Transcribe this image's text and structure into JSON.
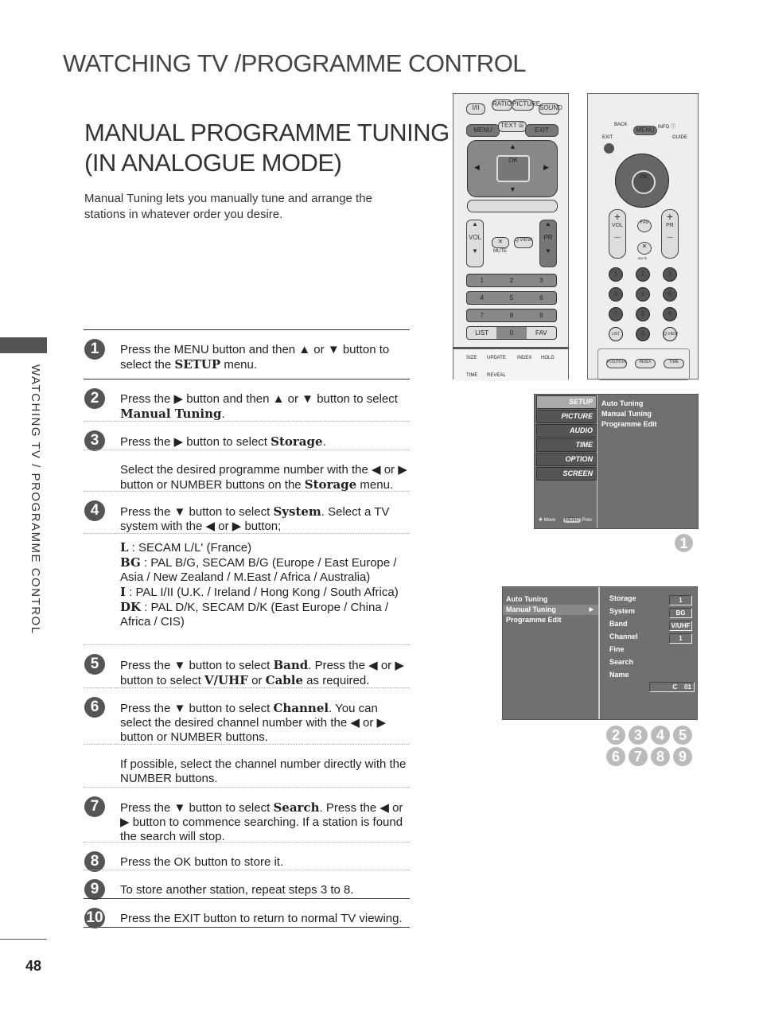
{
  "header": {
    "title": "WATCHING TV /PROGRAMME CONTROL"
  },
  "section": {
    "title_line1": "MANUAL PROGRAMME TUNING",
    "title_line2": "(IN ANALOGUE MODE)",
    "intro": "Manual Tuning lets you manually tune and arrange the stations in whatever order you desire."
  },
  "sidebar": {
    "label": "WATCHING TV / PROGRAMME CONTROL"
  },
  "page_number": "48",
  "steps": [
    {
      "num": "1",
      "segments": [
        [
          "Press the "
        ],
        [
          "MENU"
        ],
        [
          " button and then ▲ or ▼ button to select the "
        ],
        [
          "SETUP",
          "b"
        ],
        [
          " menu."
        ]
      ]
    },
    {
      "num": "2",
      "segments": [
        [
          "Press the ▶ button and then ▲ or ▼ button to select "
        ],
        [
          "Manual Tuning",
          "b"
        ],
        [
          "."
        ]
      ]
    },
    {
      "num": "3",
      "segments": [
        [
          "Press the ▶ button to select "
        ],
        [
          "Storage",
          "b"
        ],
        [
          "."
        ]
      ]
    },
    {
      "num": "",
      "segments": [
        [
          "Select the desired programme number with the ◀ or ▶ button or NUMBER buttons on the "
        ],
        [
          "Storage",
          "b"
        ],
        [
          " menu."
        ]
      ]
    },
    {
      "num": "4",
      "segments": [
        [
          "Press the ▼ button to select "
        ],
        [
          "System",
          "b"
        ],
        [
          ". Select a TV system with the ◀ or ▶ button;"
        ]
      ]
    },
    {
      "num": "",
      "segments": [
        [
          "L",
          "b"
        ],
        [
          "     : SECAM L/L' (France)\n"
        ],
        [
          "BG",
          "b"
        ],
        [
          " : PAL B/G, SECAM B/G (Europe / East Europe / Asia / New Zealand / M.East / Africa / Australia)\n"
        ],
        [
          "I",
          "b"
        ],
        [
          "      : PAL I/II (U.K. / Ireland / Hong Kong / South Africa)\n"
        ],
        [
          "DK",
          "b"
        ],
        [
          " : PAL D/K, SECAM D/K (East Europe / China / Africa / CIS)"
        ]
      ]
    },
    {
      "num": "5",
      "segments": [
        [
          "Press the ▼ button to select "
        ],
        [
          "Band",
          "b"
        ],
        [
          ". Press the ◀ or ▶ button to select "
        ],
        [
          "V/UHF",
          "b"
        ],
        [
          " or "
        ],
        [
          "Cable",
          "b"
        ],
        [
          " as required."
        ]
      ]
    },
    {
      "num": "6",
      "segments": [
        [
          "Press the ▼ button to select "
        ],
        [
          "Channel",
          "b"
        ],
        [
          ". You can select the desired channel number with the ◀ or ▶ button or NUMBER buttons."
        ]
      ]
    },
    {
      "num": "",
      "segments": [
        [
          "If possible, select the channel number directly with the NUMBER buttons."
        ]
      ]
    },
    {
      "num": "7",
      "segments": [
        [
          "Press the ▼ button to select "
        ],
        [
          "Search",
          "b"
        ],
        [
          ". Press the ◀ or ▶ button to commence searching. If a station is found the search will stop."
        ]
      ]
    },
    {
      "num": "8",
      "segments": [
        [
          "Press the "
        ],
        [
          "OK"
        ],
        [
          " button to store it."
        ]
      ]
    },
    {
      "num": "9",
      "segments": [
        [
          "To store another station, repeat steps 3 to 8."
        ]
      ]
    },
    {
      "num": "10",
      "segments": [
        [
          "Press the "
        ],
        [
          "EXIT"
        ],
        [
          " button to return to normal TV viewing."
        ]
      ]
    }
  ],
  "remote1": {
    "top_buttons": [
      "I/II",
      "RATIO",
      "PICTURE",
      "SOUND"
    ],
    "menu": "MENU",
    "text": "TEXT ☰",
    "exit": "EXIT",
    "ok": "OK",
    "up": "▲",
    "down": "▼",
    "left": "◀",
    "right": "▶",
    "vol": "VOL",
    "pr": "PR",
    "mute": "MUTE",
    "qview": "Q.VIEW",
    "numbers": [
      "1",
      "2",
      "3",
      "4",
      "5",
      "6",
      "7",
      "8",
      "9"
    ],
    "list": "LIST",
    "zero": "0",
    "fav": "FAV",
    "teletext_top": [
      "SIZE",
      "UPDATE",
      "INDEX",
      "HOLD"
    ],
    "teletext_bottom": [
      "TIME",
      "REVEAL"
    ]
  },
  "remote2": {
    "back": "BACK",
    "menu": "MENU",
    "info": "INFO ⓘ",
    "exit": "EXIT",
    "guide": "GUIDE",
    "ok": "OK",
    "vol": "VOL",
    "pr": "PR",
    "plus": "+",
    "minus": "—",
    "fav": "FAV",
    "mute": "MUTE",
    "numbers": [
      "1",
      "2",
      "3",
      "4",
      "5",
      "6",
      "7",
      "8",
      "9"
    ],
    "list": "LIST",
    "zero": "0",
    "qview": "Q.VIEW",
    "teletext": [
      "POSITION",
      "INDEX",
      "TIME"
    ]
  },
  "menu1": {
    "tabs": [
      "SETUP",
      "PICTURE",
      "AUDIO",
      "TIME",
      "OPTION",
      "SCREEN"
    ],
    "items": [
      "Auto Tuning",
      "Manual Tuning",
      "Programme Edit"
    ],
    "footer_move": "Move",
    "footer_menu": "MENU",
    "footer_prev": "Prev.",
    "badge": "1"
  },
  "menu2": {
    "items": [
      "Auto Tuning",
      "Manual Tuning",
      "Programme Edit"
    ],
    "arrow": "▶",
    "fields": [
      {
        "label": "Storage",
        "value": "1"
      },
      {
        "label": "System",
        "value": "BG"
      },
      {
        "label": "Band",
        "value": "V/UHF"
      },
      {
        "label": "Channel",
        "value": "1"
      },
      {
        "label": "Fine",
        "value": ""
      },
      {
        "label": "Search",
        "value": ""
      },
      {
        "label": "Name",
        "value": "C    01"
      }
    ],
    "badges": [
      "2",
      "3",
      "4",
      "5",
      "6",
      "7",
      "8",
      "9"
    ]
  }
}
